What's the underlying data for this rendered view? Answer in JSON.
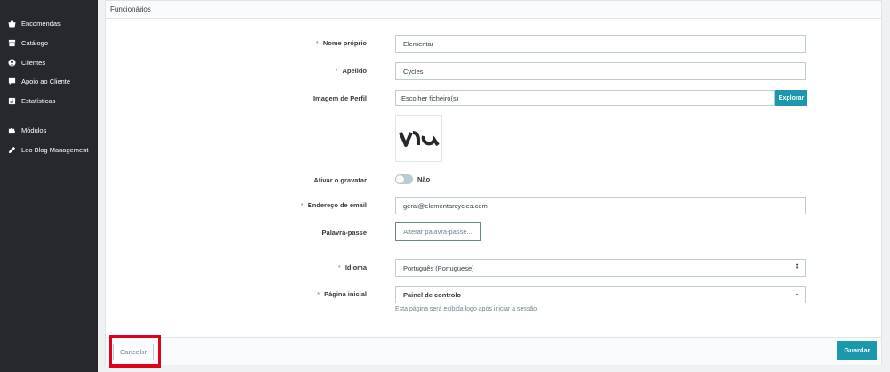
{
  "sidebar": {
    "items": [
      {
        "label": "Encomendas",
        "icon": "shopping-basket-icon"
      },
      {
        "label": "Catálogo",
        "icon": "store-icon"
      },
      {
        "label": "Clientes",
        "icon": "user-circle-icon"
      },
      {
        "label": "Apoio ao Cliente",
        "icon": "chat-bubble-icon"
      },
      {
        "label": "Estatísticas",
        "icon": "bar-chart-icon"
      },
      {
        "label": "Módulos",
        "icon": "puzzle-icon"
      },
      {
        "label": "Leo Blog Management",
        "icon": "pencil-icon"
      }
    ]
  },
  "panel": {
    "title": "Funcionários"
  },
  "form": {
    "first_name": {
      "label": "Nome próprio",
      "value": "Elementar",
      "required": true
    },
    "last_name": {
      "label": "Apelido",
      "value": "Cycles",
      "required": true
    },
    "avatar": {
      "label": "Imagem de Perfil",
      "placeholder": "Escolher ficheiro(s)",
      "button": "Explorar"
    },
    "gravatar": {
      "label": "Ativar o gravatar",
      "state_label": "Não",
      "enabled": false
    },
    "email": {
      "label": "Endereço de email",
      "value": "geral@elementarcycles.com",
      "required": true
    },
    "password": {
      "label": "Palavra-passe",
      "button": "Alterar palavra-passe..."
    },
    "language": {
      "label": "Idioma",
      "value": "Português (Portuguese)",
      "required": true
    },
    "homepage": {
      "label": "Página inicial",
      "value": "Painel de controlo",
      "required": true,
      "help": "Esta página será exibida logo após iniciar a sessão."
    }
  },
  "footer": {
    "cancel": "Cancelar",
    "save": "Guardar"
  },
  "colors": {
    "sidebar_bg": "#25282d",
    "accent": "#1b98ad",
    "required": "#c05c67",
    "highlight": "#e3001b"
  }
}
